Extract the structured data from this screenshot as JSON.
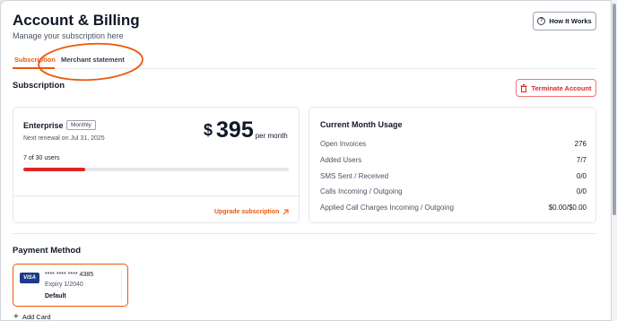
{
  "header": {
    "title": "Account & Billing",
    "subtitle": "Manage your subscription here",
    "how_it_works": "How It Works"
  },
  "tabs": [
    {
      "label": "Subscription",
      "active": true
    },
    {
      "label": "Merchant statement",
      "active": false
    }
  ],
  "subscription": {
    "section_title": "Subscription",
    "terminate_label": "Terminate Account",
    "plan": {
      "name": "Enterprise",
      "billing_cycle": "Monthly",
      "renewal": "Next renewal on Jul 31, 2025",
      "currency": "$",
      "amount": "395",
      "period": "per month",
      "users_label": "7 of 30 users",
      "usage_fraction": 0.233,
      "upgrade_label": "Upgrade subscription"
    },
    "usage": {
      "title": "Current Month Usage",
      "rows": [
        {
          "label": "Open Invoices",
          "value": "276"
        },
        {
          "label": "Added Users",
          "value": "7/7"
        },
        {
          "label": "SMS Sent / Received",
          "value": "0/0"
        },
        {
          "label": "Calls Incoming / Outgoing",
          "value": "0/0"
        },
        {
          "label": "Applied Call Charges Incoming / Outgoing",
          "value": "$0.00/$0.00"
        }
      ]
    }
  },
  "payment": {
    "section_title": "Payment Method",
    "card": {
      "brand": "VISA",
      "number": "**** **** **** 4385",
      "expiry": "Expiry 1/2040",
      "status": "Default"
    },
    "add_card": "Add Card"
  },
  "colors": {
    "accent": "#ea580c",
    "danger": "#dc2626",
    "annotation": "#ea580c"
  }
}
